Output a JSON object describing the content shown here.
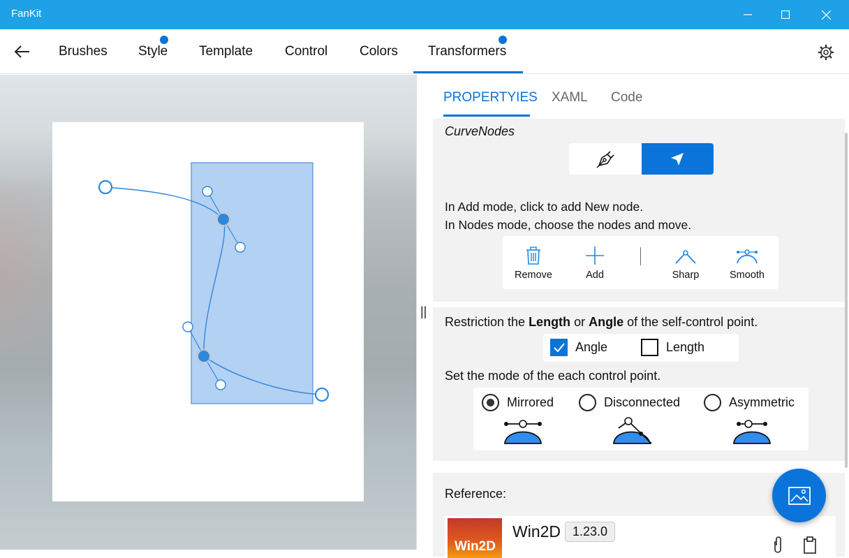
{
  "window": {
    "title": "FanKit",
    "minimize_icon": "minimize-icon",
    "maximize_icon": "maximize-icon",
    "close_icon": "close-icon"
  },
  "nav": {
    "back_icon": "back-arrow-icon",
    "tabs": [
      {
        "label": "Brushes",
        "has_dot": false
      },
      {
        "label": "Style",
        "has_dot": true
      },
      {
        "label": "Template",
        "has_dot": false
      },
      {
        "label": "Control",
        "has_dot": false
      },
      {
        "label": "Colors",
        "has_dot": false
      },
      {
        "label": "Transformers",
        "has_dot": true,
        "active": true
      }
    ],
    "settings_icon": "gear-icon",
    "accent_color": "#0a74da"
  },
  "panel": {
    "tabs": [
      {
        "label": "PROPERTYIES",
        "active": true
      },
      {
        "label": "XAML",
        "active": false
      },
      {
        "label": "Code",
        "active": false
      }
    ],
    "curve_nodes": {
      "title": "CurveNodes",
      "mode_buttons": [
        {
          "icon": "pen-icon",
          "selected": false
        },
        {
          "icon": "cursor-icon",
          "selected": true
        }
      ],
      "help_lines": [
        "In Add mode, click to add New node.",
        "In Nodes mode, choose the nodes and move."
      ],
      "tools": [
        {
          "label": "Remove",
          "icon": "trash-icon"
        },
        {
          "label": "Add",
          "icon": "plus-icon"
        },
        {
          "label": "Sharp",
          "icon": "sharp-node-icon"
        },
        {
          "label": "Smooth",
          "icon": "smooth-node-icon"
        }
      ]
    },
    "restriction": {
      "text_before": "Restriction the ",
      "bold_length": "Length",
      "text_or": " or ",
      "bold_angle": "Angle",
      "text_after": " of the self-control point.",
      "checkboxes": [
        {
          "label": "Angle",
          "checked": true
        },
        {
          "label": "Length",
          "checked": false
        }
      ],
      "mode_text": "Set the mode of the each control point.",
      "radios": [
        {
          "label": "Mirrored",
          "selected": true
        },
        {
          "label": "Disconnected",
          "selected": false
        },
        {
          "label": "Asymmetric",
          "selected": false
        }
      ]
    },
    "reference": {
      "label": "Reference:",
      "name": "Win2D",
      "version": "1.23.0",
      "thumb_text": "Win2D",
      "attach_icon": "paperclip-icon",
      "clipboard_icon": "clipboard-icon"
    }
  },
  "fab": {
    "icon": "image-icon"
  },
  "splitter": {
    "grip_text": "||"
  }
}
